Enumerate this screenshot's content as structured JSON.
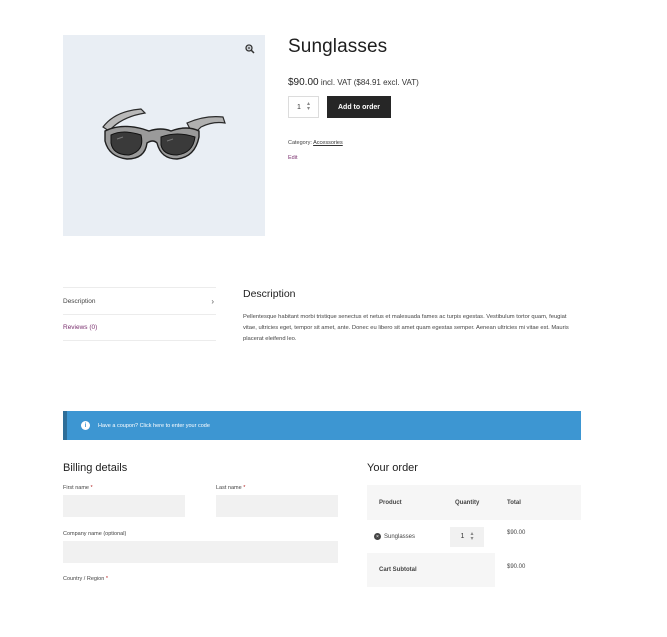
{
  "product": {
    "title": "Sunglasses",
    "price": "$90.00",
    "price_suffix": "incl. VAT ($84.91 excl. VAT)",
    "quantity": "1",
    "add_button": "Add to order",
    "category_label": "Category:",
    "category_value": "Accessories",
    "edit_link": "Edit"
  },
  "tabs": [
    {
      "label": "Description"
    },
    {
      "label": "Reviews (0)"
    }
  ],
  "description": {
    "title": "Description",
    "text": "Pellentesque habitant morbi tristique senectus et netus et malesuada fames ac turpis egestas. Vestibulum tortor quam, feugiat vitae, ultricies eget, tempor sit amet, ante. Donec eu libero sit amet quam egestas semper. Aenean ultricies mi vitae est. Mauris placerat eleifend leo."
  },
  "coupon": {
    "text": "Have a coupon? Click here to enter your code"
  },
  "billing": {
    "title": "Billing details",
    "first_name": "First name",
    "last_name": "Last name",
    "company": "Company name (optional)",
    "country": "Country / Region",
    "required_mark": "*"
  },
  "order": {
    "title": "Your order",
    "headers": {
      "product": "Product",
      "quantity": "Quantity",
      "total": "Total"
    },
    "items": [
      {
        "name": "Sunglasses",
        "quantity": "1",
        "total": "$90.00"
      }
    ],
    "subtotal_label": "Cart Subtotal",
    "subtotal_value": "$90.00"
  },
  "colors": {
    "accent_purple": "#7a2f6e",
    "coupon_blue": "#3d96d2",
    "button_dark": "#262626",
    "image_bg": "#e9eef4"
  },
  "icons": {
    "zoom": "magnifier-icon",
    "info": "info-icon",
    "remove": "remove-icon",
    "chevron": "chevron-right-icon"
  }
}
